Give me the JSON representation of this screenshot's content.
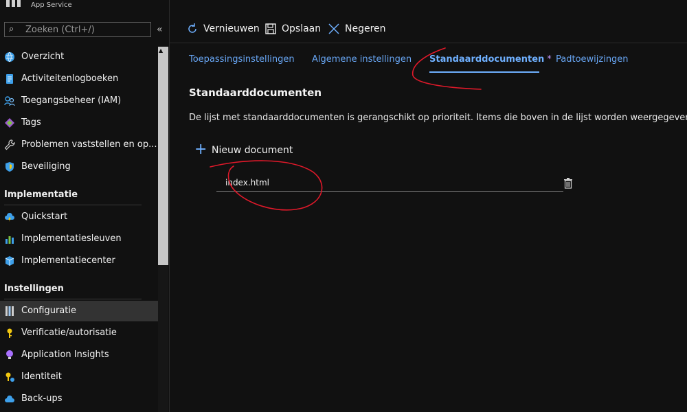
{
  "app": {
    "subtitle": "App Service"
  },
  "sidebar": {
    "search_placeholder": "Zoeken (Ctrl+/)",
    "collapse_glyph": "«",
    "items": [
      {
        "label": "Overzicht",
        "icon": "globe-icon",
        "color": "#3ea0ea"
      },
      {
        "label": "Activiteitenlogboeken",
        "icon": "log-icon",
        "color": "#3ea0ea"
      },
      {
        "label": "Toegangsbeheer (IAM)",
        "icon": "people-icon",
        "color": "#3ea0ea"
      },
      {
        "label": "Tags",
        "icon": "tag-icon",
        "color": "#9b59d0"
      },
      {
        "label": "Problemen vaststellen en op...",
        "icon": "wrench-icon",
        "color": "#d0d0d0"
      },
      {
        "label": "Beveiliging",
        "icon": "shield-icon",
        "color": "#3ea0ea"
      }
    ],
    "section_implementatie": "Implementatie",
    "impl_items": [
      {
        "label": "Quickstart",
        "icon": "cloud-lightning-icon",
        "color": "#3ea0ea"
      },
      {
        "label": "Implementatiesleuven",
        "icon": "slots-icon",
        "color": "#7cc242"
      },
      {
        "label": "Implementatiecenter",
        "icon": "cube-icon",
        "color": "#3ea0ea"
      }
    ],
    "section_instellingen": "Instellingen",
    "settings_items": [
      {
        "label": "Configuratie",
        "icon": "sliders-icon",
        "color": "#d0d0d0",
        "active": true
      },
      {
        "label": "Verificatie/autorisatie",
        "icon": "key-icon",
        "color": "#f2c811"
      },
      {
        "label": "Application Insights",
        "icon": "bulb-icon",
        "color": "#a970ff"
      },
      {
        "label": "Identiteit",
        "icon": "identity-key-icon",
        "color": "#f2c811"
      },
      {
        "label": "Back-ups",
        "icon": "backup-cloud-icon",
        "color": "#3ea0ea"
      }
    ]
  },
  "toolbar": {
    "refresh_label": "Vernieuwen",
    "save_label": "Opslaan",
    "discard_label": "Negeren"
  },
  "tabs": [
    {
      "label": "Toepassingsinstellingen",
      "active": false
    },
    {
      "label": "Algemene instellingen",
      "active": false
    },
    {
      "label": "Standaarddocumenten",
      "active": true,
      "modified_marker": "*"
    },
    {
      "label": "Padtoewijzingen",
      "active": false
    }
  ],
  "main": {
    "title": "Standaarddocumenten",
    "description": "De lijst met standaarddocumenten is gerangschikt op prioriteit. Items die boven in de lijst worden weergegeven, hebb",
    "new_document_label": "Nieuw document",
    "documents": [
      {
        "value": "index.html"
      }
    ]
  },
  "colors": {
    "background": "#111111",
    "accent": "#6fb0ff",
    "annotation": "#e0192a"
  }
}
